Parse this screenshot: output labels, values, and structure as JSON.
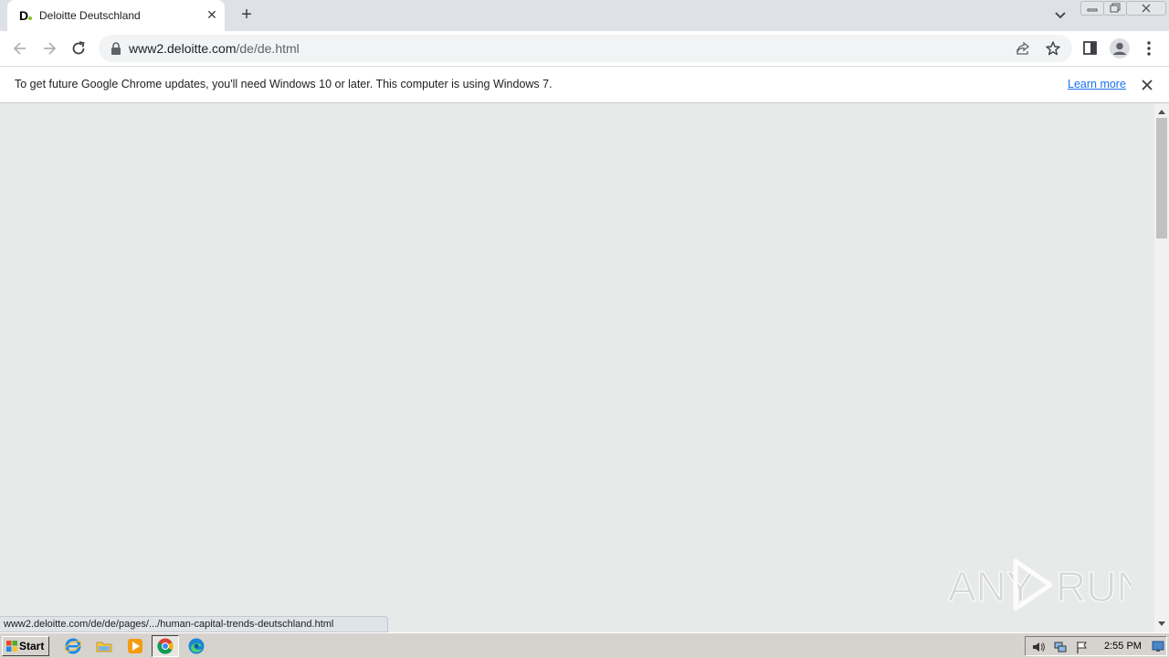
{
  "browser": {
    "tab": {
      "favicon_letter": "D",
      "title": "Deloitte Deutschland",
      "close_glyph": "✕"
    },
    "new_tab_glyph": "+",
    "address": {
      "host": "www2.deloitte.com",
      "path": "/de/de.html"
    }
  },
  "infobar": {
    "message": "To get future Google Chrome updates, you'll need Windows 10 or later. This computer is using Windows 7.",
    "link_label": "Learn more"
  },
  "status_bubble": {
    "text": "www2.deloitte.com/de/de/pages/.../human-capital-trends-deutschland.html"
  },
  "watermark": {
    "left": "ANY",
    "right": "RUN"
  },
  "taskbar": {
    "start_label": "Start",
    "clock": "2:55 PM"
  },
  "colors": {
    "content_bg": "#e7eae9",
    "tabstrip_bg": "#dee1e6",
    "link": "#1a73e8",
    "deloitte_green": "#86bc25"
  },
  "icons": [
    "back-icon",
    "forward-icon",
    "reload-icon",
    "lock-icon",
    "share-icon",
    "star-icon",
    "side-panel-icon",
    "profile-icon",
    "menu-icon",
    "close-icon",
    "ie-icon",
    "explorer-icon",
    "media-player-icon",
    "chrome-icon",
    "edge-icon",
    "volume-icon",
    "network-icon",
    "flag-icon"
  ]
}
